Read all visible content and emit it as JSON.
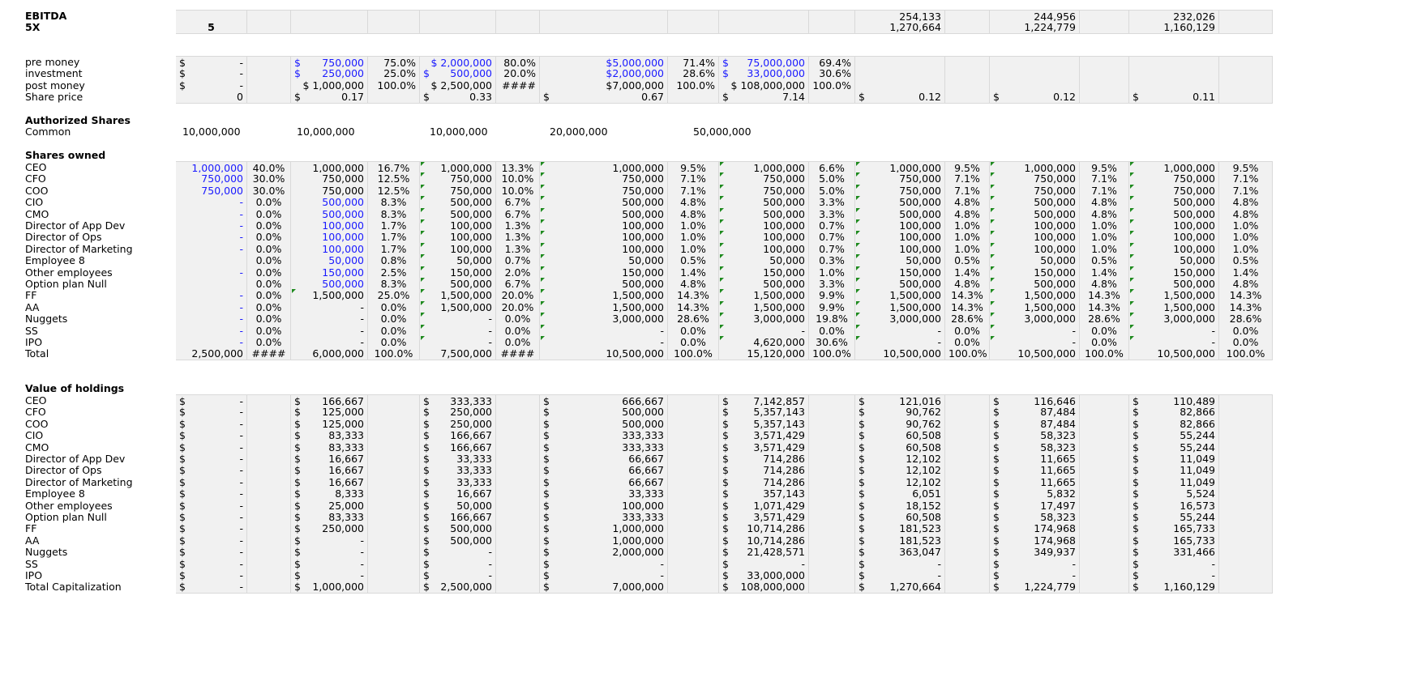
{
  "ebitda": {
    "label": "EBITDA",
    "values": [
      "254,133",
      "244,956",
      "232,026"
    ]
  },
  "multiple": {
    "label": "5X",
    "factor": "5",
    "values": [
      "1,270,664",
      "1,224,779",
      "1,160,129"
    ]
  },
  "valuation": {
    "pre_money": {
      "label": "pre money",
      "cells": [
        "$|-",
        "",
        "$|750,000",
        "75.0%",
        "$ 2,000,000",
        "80.0%",
        "$5,000,000",
        "71.4%",
        "$|75,000,000",
        "69.4%"
      ]
    },
    "investment": {
      "label": "investment",
      "cells": [
        "$|-",
        "",
        "$|250,000",
        "25.0%",
        "$|500,000",
        "20.0%",
        "$2,000,000",
        "28.6%",
        "$|33,000,000",
        "30.6%"
      ]
    },
    "post_money": {
      "label": "post money",
      "cells": [
        "$|-",
        "",
        "$ 1,000,000",
        "100.0%",
        "$ 2,500,000",
        "####",
        "$7,000,000",
        "100.0%",
        "$ 108,000,000",
        "100.0%"
      ]
    },
    "share_price": {
      "label": "Share price",
      "cells": [
        "0",
        "",
        "$|0.17",
        "",
        "$|0.33",
        "",
        "$|0.67",
        "",
        "$|7.14",
        "",
        "$|0.12",
        "",
        "$|0.12",
        "",
        "$|0.11",
        ""
      ]
    }
  },
  "authorized": {
    "heading": "Authorized Shares",
    "label": "Common",
    "values": [
      "10,000,000",
      "10,000,000",
      "10,000,000",
      "20,000,000",
      "50,000,000"
    ]
  },
  "shares_owned": {
    "heading": "Shares owned",
    "rows": [
      {
        "label": "CEO",
        "cells": [
          "1,000,000",
          "40.0%",
          "1,000,000",
          "16.7%",
          "1,000,000",
          "13.3%",
          "1,000,000",
          "9.5%",
          "1,000,000",
          "6.6%",
          "1,000,000",
          "9.5%",
          "1,000,000",
          "9.5%",
          "1,000,000",
          "9.5%"
        ]
      },
      {
        "label": "CFO",
        "cells": [
          "750,000",
          "30.0%",
          "750,000",
          "12.5%",
          "750,000",
          "10.0%",
          "750,000",
          "7.1%",
          "750,000",
          "5.0%",
          "750,000",
          "7.1%",
          "750,000",
          "7.1%",
          "750,000",
          "7.1%"
        ]
      },
      {
        "label": "COO",
        "cells": [
          "750,000",
          "30.0%",
          "750,000",
          "12.5%",
          "750,000",
          "10.0%",
          "750,000",
          "7.1%",
          "750,000",
          "5.0%",
          "750,000",
          "7.1%",
          "750,000",
          "7.1%",
          "750,000",
          "7.1%"
        ]
      },
      {
        "label": "CIO",
        "cells": [
          "-",
          "0.0%",
          "500,000",
          "8.3%",
          "500,000",
          "6.7%",
          "500,000",
          "4.8%",
          "500,000",
          "3.3%",
          "500,000",
          "4.8%",
          "500,000",
          "4.8%",
          "500,000",
          "4.8%"
        ]
      },
      {
        "label": "CMO",
        "cells": [
          "-",
          "0.0%",
          "500,000",
          "8.3%",
          "500,000",
          "6.7%",
          "500,000",
          "4.8%",
          "500,000",
          "3.3%",
          "500,000",
          "4.8%",
          "500,000",
          "4.8%",
          "500,000",
          "4.8%"
        ]
      },
      {
        "label": "Director of App Dev",
        "cells": [
          "-",
          "0.0%",
          "100,000",
          "1.7%",
          "100,000",
          "1.3%",
          "100,000",
          "1.0%",
          "100,000",
          "0.7%",
          "100,000",
          "1.0%",
          "100,000",
          "1.0%",
          "100,000",
          "1.0%"
        ]
      },
      {
        "label": "Director of Ops",
        "cells": [
          "-",
          "0.0%",
          "100,000",
          "1.7%",
          "100,000",
          "1.3%",
          "100,000",
          "1.0%",
          "100,000",
          "0.7%",
          "100,000",
          "1.0%",
          "100,000",
          "1.0%",
          "100,000",
          "1.0%"
        ]
      },
      {
        "label": "Director of Marketing",
        "cells": [
          "-",
          "0.0%",
          "100,000",
          "1.7%",
          "100,000",
          "1.3%",
          "100,000",
          "1.0%",
          "100,000",
          "0.7%",
          "100,000",
          "1.0%",
          "100,000",
          "1.0%",
          "100,000",
          "1.0%"
        ]
      },
      {
        "label": "Employee 8",
        "cells": [
          "",
          "0.0%",
          "50,000",
          "0.8%",
          "50,000",
          "0.7%",
          "50,000",
          "0.5%",
          "50,000",
          "0.3%",
          "50,000",
          "0.5%",
          "50,000",
          "0.5%",
          "50,000",
          "0.5%"
        ]
      },
      {
        "label": "Other employees",
        "cells": [
          "-",
          "0.0%",
          "150,000",
          "2.5%",
          "150,000",
          "2.0%",
          "150,000",
          "1.4%",
          "150,000",
          "1.0%",
          "150,000",
          "1.4%",
          "150,000",
          "1.4%",
          "150,000",
          "1.4%"
        ]
      },
      {
        "label": "Option plan Null",
        "cells": [
          "",
          "0.0%",
          "500,000",
          "8.3%",
          "500,000",
          "6.7%",
          "500,000",
          "4.8%",
          "500,000",
          "3.3%",
          "500,000",
          "4.8%",
          "500,000",
          "4.8%",
          "500,000",
          "4.8%"
        ]
      },
      {
        "label": "FF",
        "cells": [
          "-",
          "0.0%",
          "1,500,000",
          "25.0%",
          "1,500,000",
          "20.0%",
          "1,500,000",
          "14.3%",
          "1,500,000",
          "9.9%",
          "1,500,000",
          "14.3%",
          "1,500,000",
          "14.3%",
          "1,500,000",
          "14.3%"
        ]
      },
      {
        "label": "AA",
        "cells": [
          "-",
          "0.0%",
          "-",
          "0.0%",
          "1,500,000",
          "20.0%",
          "1,500,000",
          "14.3%",
          "1,500,000",
          "9.9%",
          "1,500,000",
          "14.3%",
          "1,500,000",
          "14.3%",
          "1,500,000",
          "14.3%"
        ]
      },
      {
        "label": "Nuggets",
        "cells": [
          "-",
          "0.0%",
          "-",
          "0.0%",
          "-",
          "0.0%",
          "3,000,000",
          "28.6%",
          "3,000,000",
          "19.8%",
          "3,000,000",
          "28.6%",
          "3,000,000",
          "28.6%",
          "3,000,000",
          "28.6%"
        ]
      },
      {
        "label": "SS",
        "cells": [
          "-",
          "0.0%",
          "-",
          "0.0%",
          "-",
          "0.0%",
          "-",
          "0.0%",
          "-",
          "0.0%",
          "-",
          "0.0%",
          "-",
          "0.0%",
          "-",
          "0.0%"
        ]
      },
      {
        "label": "IPO",
        "cells": [
          "-",
          "0.0%",
          "-",
          "0.0%",
          "-",
          "0.0%",
          "-",
          "0.0%",
          "4,620,000",
          "30.6%",
          "-",
          "0.0%",
          "-",
          "0.0%",
          "-",
          "0.0%"
        ]
      },
      {
        "label": "Total",
        "cells": [
          "2,500,000",
          "####",
          "6,000,000",
          "100.0%",
          "7,500,000",
          "####",
          "10,500,000",
          "100.0%",
          "15,120,000",
          "100.0%",
          "10,500,000",
          "100.0%",
          "10,500,000",
          "100.0%",
          "10,500,000",
          "100.0%"
        ]
      }
    ]
  },
  "value_of_holdings": {
    "heading": "Value of holdings",
    "rows": [
      {
        "label": "CEO",
        "cells": [
          "-",
          "166,667",
          "333,333",
          "666,667",
          "7,142,857",
          "121,016",
          "116,646",
          "110,489"
        ]
      },
      {
        "label": "CFO",
        "cells": [
          "-",
          "125,000",
          "250,000",
          "500,000",
          "5,357,143",
          "90,762",
          "87,484",
          "82,866"
        ]
      },
      {
        "label": "COO",
        "cells": [
          "-",
          "125,000",
          "250,000",
          "500,000",
          "5,357,143",
          "90,762",
          "87,484",
          "82,866"
        ]
      },
      {
        "label": "CIO",
        "cells": [
          "-",
          "83,333",
          "166,667",
          "333,333",
          "3,571,429",
          "60,508",
          "58,323",
          "55,244"
        ]
      },
      {
        "label": "CMO",
        "cells": [
          "-",
          "83,333",
          "166,667",
          "333,333",
          "3,571,429",
          "60,508",
          "58,323",
          "55,244"
        ]
      },
      {
        "label": "Director of App Dev",
        "cells": [
          "-",
          "16,667",
          "33,333",
          "66,667",
          "714,286",
          "12,102",
          "11,665",
          "11,049"
        ]
      },
      {
        "label": "Director of Ops",
        "cells": [
          "-",
          "16,667",
          "33,333",
          "66,667",
          "714,286",
          "12,102",
          "11,665",
          "11,049"
        ]
      },
      {
        "label": "Director of Marketing",
        "cells": [
          "-",
          "16,667",
          "33,333",
          "66,667",
          "714,286",
          "12,102",
          "11,665",
          "11,049"
        ]
      },
      {
        "label": "Employee 8",
        "cells": [
          "-",
          "8,333",
          "16,667",
          "33,333",
          "357,143",
          "6,051",
          "5,832",
          "5,524"
        ]
      },
      {
        "label": "Other employees",
        "cells": [
          "-",
          "25,000",
          "50,000",
          "100,000",
          "1,071,429",
          "18,152",
          "17,497",
          "16,573"
        ]
      },
      {
        "label": "Option plan Null",
        "cells": [
          "-",
          "83,333",
          "166,667",
          "333,333",
          "3,571,429",
          "60,508",
          "58,323",
          "55,244"
        ]
      },
      {
        "label": "FF",
        "cells": [
          "-",
          "250,000",
          "500,000",
          "1,000,000",
          "10,714,286",
          "181,523",
          "174,968",
          "165,733"
        ]
      },
      {
        "label": "AA",
        "cells": [
          "-",
          "-",
          "500,000",
          "1,000,000",
          "10,714,286",
          "181,523",
          "174,968",
          "165,733"
        ]
      },
      {
        "label": "Nuggets",
        "cells": [
          "-",
          "-",
          "-",
          "2,000,000",
          "21,428,571",
          "363,047",
          "349,937",
          "331,466"
        ]
      },
      {
        "label": "SS",
        "cells": [
          "-",
          "-",
          "-",
          "-",
          "-",
          "-",
          "-",
          "-"
        ]
      },
      {
        "label": "IPO",
        "cells": [
          "-",
          "-",
          "-",
          "-",
          "33,000,000",
          "-",
          "-",
          "-"
        ]
      },
      {
        "label": "Total Capitalization",
        "cells": [
          "-",
          "1,000,000",
          "2,500,000",
          "7,000,000",
          "108,000,000",
          "1,270,664",
          "1,224,779",
          "1,160,129"
        ]
      }
    ]
  },
  "colors": {
    "input_blue": "#1a1aff",
    "cell_bg": "#f1f1f1",
    "grid_line": "#d9d9d9",
    "comment_triangle": "#1e8a1e"
  }
}
